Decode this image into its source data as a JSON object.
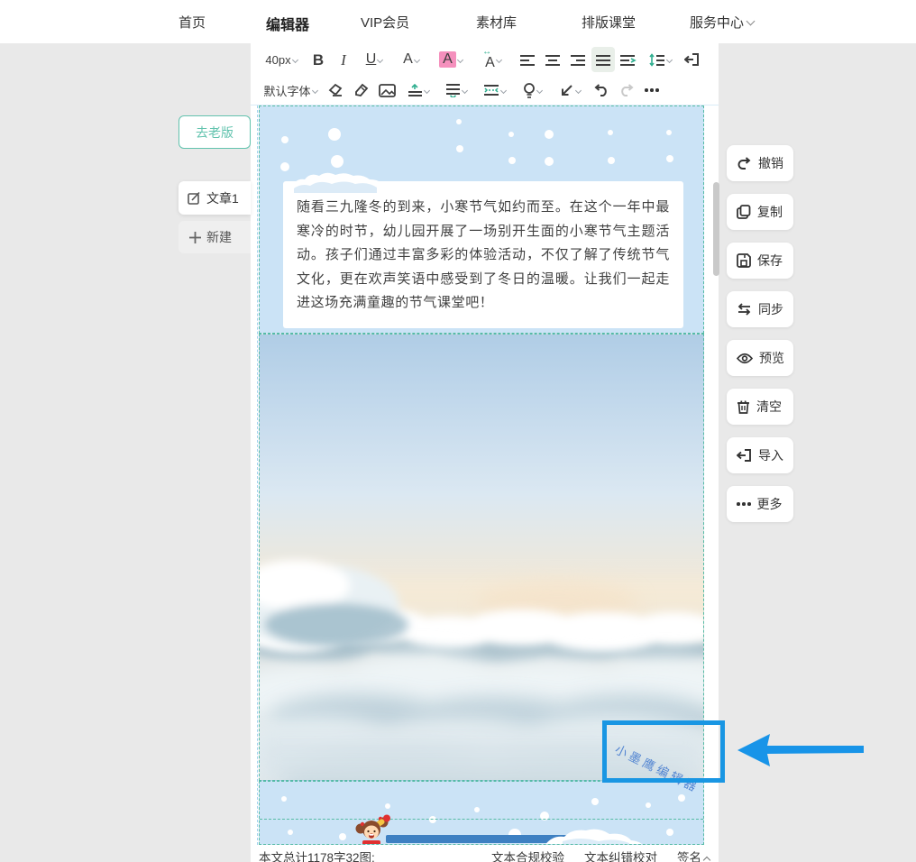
{
  "nav": {
    "items": [
      {
        "label": "首页",
        "active": false
      },
      {
        "label": "编辑器",
        "active": true
      },
      {
        "label": "VIP会员",
        "active": false
      },
      {
        "label": "素材库",
        "active": false
      },
      {
        "label": "排版课堂",
        "active": false
      },
      {
        "label": "服务中心",
        "active": false,
        "has_dropdown": true
      }
    ]
  },
  "toolbar": {
    "font_size": "40px",
    "font_family": "默认字体",
    "bold": "B",
    "italic": "I",
    "underline": "U",
    "font_color": "A",
    "highlight_color": "A",
    "letter_spacing_glyph": "A",
    "active_align": "align-justify"
  },
  "sidebar": {
    "go_old_version": "去老版",
    "article_tab": "文章1",
    "new_article": "新建"
  },
  "actions": [
    {
      "label": "撤销",
      "icon": "undo-icon"
    },
    {
      "label": "复制",
      "icon": "copy-icon"
    },
    {
      "label": "保存",
      "icon": "save-icon"
    },
    {
      "label": "同步",
      "icon": "sync-icon"
    },
    {
      "label": "预览",
      "icon": "eye-icon"
    },
    {
      "label": "清空",
      "icon": "trash-icon"
    },
    {
      "label": "导入",
      "icon": "import-icon"
    },
    {
      "label": "更多",
      "icon": "more-icon"
    }
  ],
  "article": {
    "paragraph": "随看三九隆冬的到来，小寒节气如约而至。在这个一年中最寒冷的时节，幼儿园开展了一场别开生面的小寒节气主题活动。孩子们通过丰富多彩的体验活动，不仅了解了传统节气文化，更在欢声笑语中感受到了冬日的温暖。让我们一起走进这场充满童趣的节气课堂吧！",
    "watermark": "小墨鹰编辑器"
  },
  "statusbar": {
    "summary": "本文总计1178字32图;",
    "check_compliance": "文本合规校验",
    "check_proofread": "文本纠错校对",
    "signature": "签名"
  },
  "colors": {
    "accent_teal": "#56bba6",
    "section_blue": "#cbe3f6",
    "annotation_blue": "#1996e3",
    "highlight_pink": "#f590bd",
    "content_bar_blue": "#3e80c2",
    "watermark_blue": "#4a7fd0"
  }
}
